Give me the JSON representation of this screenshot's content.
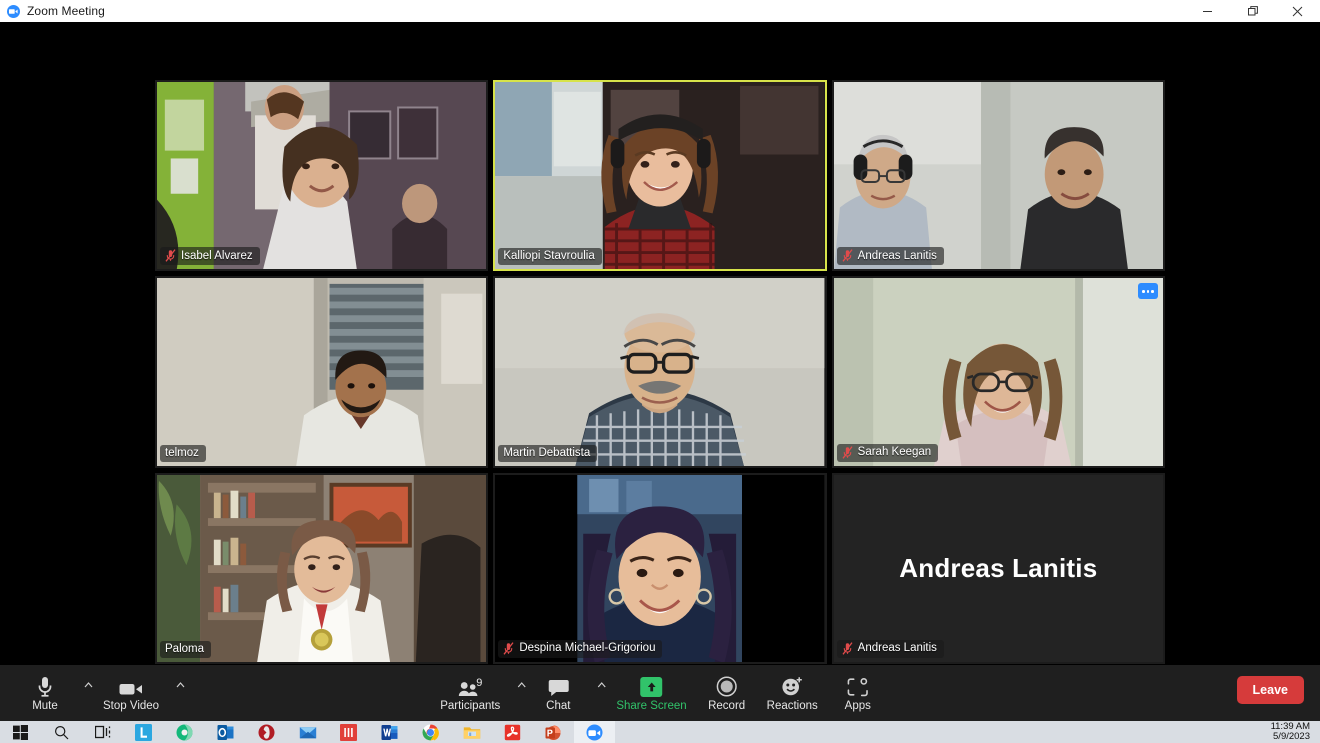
{
  "window": {
    "title": "Zoom Meeting",
    "logo_icon": "zoom-logo-icon",
    "minimize_icon": "minimize-icon",
    "restore_icon": "restore-icon",
    "close_icon": "close-icon"
  },
  "gallery": {
    "tiles": [
      {
        "name": "Isabel Alvarez",
        "muted": true,
        "active_speaker": false,
        "video_on": true,
        "more_button": false
      },
      {
        "name": "Kalliopi Stavroulia",
        "muted": false,
        "active_speaker": true,
        "video_on": true,
        "more_button": false
      },
      {
        "name": "Andreas Lanitis",
        "muted": true,
        "active_speaker": false,
        "video_on": true,
        "more_button": false
      },
      {
        "name": "telmoz",
        "muted": false,
        "active_speaker": false,
        "video_on": true,
        "more_button": false
      },
      {
        "name": "Martin Debattista",
        "muted": false,
        "active_speaker": false,
        "video_on": true,
        "more_button": false
      },
      {
        "name": "Sarah Keegan",
        "muted": true,
        "active_speaker": false,
        "video_on": true,
        "more_button": true
      },
      {
        "name": "Paloma",
        "muted": false,
        "active_speaker": false,
        "video_on": true,
        "more_button": false
      },
      {
        "name": "Despina Michael-Grigoriou",
        "muted": true,
        "active_speaker": false,
        "video_on": true,
        "more_button": false
      },
      {
        "name": "Andreas Lanitis",
        "muted": true,
        "active_speaker": false,
        "video_on": false,
        "more_button": false,
        "display_name": "Andreas Lanitis"
      }
    ],
    "active_speaker_border_color": "#d7e34a",
    "more_button_color": "#2d8cff"
  },
  "toolbar": {
    "mute": {
      "label": "Mute",
      "icon": "microphone-icon",
      "has_caret": true
    },
    "video": {
      "label": "Stop Video",
      "icon": "camera-icon",
      "has_caret": true
    },
    "participants": {
      "label": "Participants",
      "icon": "participants-icon",
      "count": "9",
      "has_caret": true
    },
    "chat": {
      "label": "Chat",
      "icon": "chat-bubble-icon",
      "has_caret": true
    },
    "share": {
      "label": "Share Screen",
      "icon": "share-arrow-up-icon",
      "color": "#31c36a"
    },
    "record": {
      "label": "Record",
      "icon": "record-circle-icon"
    },
    "reactions": {
      "label": "Reactions",
      "icon": "smiley-plus-icon"
    },
    "apps": {
      "label": "Apps",
      "icon": "apps-brackets-icon"
    },
    "leave": {
      "label": "Leave",
      "color": "#d63b3b"
    }
  },
  "taskbar": {
    "items": [
      {
        "name": "start-button",
        "icon": "windows-logo-icon"
      },
      {
        "name": "search-button",
        "icon": "search-icon"
      },
      {
        "name": "task-view-button",
        "icon": "task-view-icon"
      },
      {
        "name": "taskbar-app-lastpass",
        "icon": "lastpass-icon"
      },
      {
        "name": "taskbar-app-browser",
        "icon": "browser-circle-icon"
      },
      {
        "name": "taskbar-app-outlook",
        "icon": "outlook-icon"
      },
      {
        "name": "taskbar-app-opera",
        "icon": "opera-icon"
      },
      {
        "name": "taskbar-app-mail",
        "icon": "mail-envelope-icon"
      },
      {
        "name": "taskbar-app-mendeley",
        "icon": "mendeley-icon"
      },
      {
        "name": "taskbar-app-word",
        "icon": "word-icon"
      },
      {
        "name": "taskbar-app-chrome",
        "icon": "chrome-icon"
      },
      {
        "name": "taskbar-app-file-explorer",
        "icon": "folder-icon"
      },
      {
        "name": "taskbar-app-acrobat",
        "icon": "acrobat-icon"
      },
      {
        "name": "taskbar-app-powerpoint",
        "icon": "powerpoint-icon"
      },
      {
        "name": "taskbar-app-zoom",
        "icon": "zoom-icon",
        "active": true
      }
    ],
    "clock": {
      "time": "11:39 AM",
      "date": "5/9/2023"
    }
  }
}
